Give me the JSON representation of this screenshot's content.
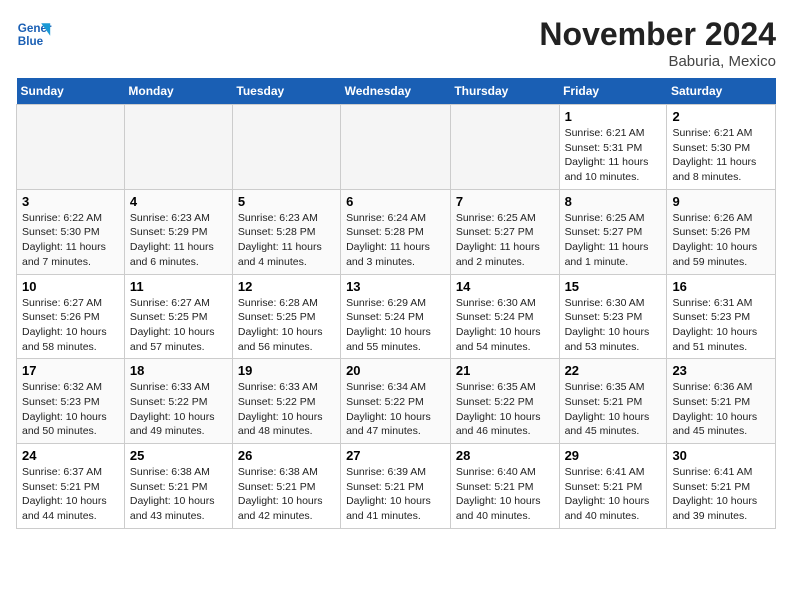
{
  "header": {
    "logo_line1": "General",
    "logo_line2": "Blue",
    "month": "November 2024",
    "location": "Baburia, Mexico"
  },
  "weekdays": [
    "Sunday",
    "Monday",
    "Tuesday",
    "Wednesday",
    "Thursday",
    "Friday",
    "Saturday"
  ],
  "weeks": [
    [
      {
        "day": "",
        "info": ""
      },
      {
        "day": "",
        "info": ""
      },
      {
        "day": "",
        "info": ""
      },
      {
        "day": "",
        "info": ""
      },
      {
        "day": "",
        "info": ""
      },
      {
        "day": "1",
        "info": "Sunrise: 6:21 AM\nSunset: 5:31 PM\nDaylight: 11 hours and 10 minutes."
      },
      {
        "day": "2",
        "info": "Sunrise: 6:21 AM\nSunset: 5:30 PM\nDaylight: 11 hours and 8 minutes."
      }
    ],
    [
      {
        "day": "3",
        "info": "Sunrise: 6:22 AM\nSunset: 5:30 PM\nDaylight: 11 hours and 7 minutes."
      },
      {
        "day": "4",
        "info": "Sunrise: 6:23 AM\nSunset: 5:29 PM\nDaylight: 11 hours and 6 minutes."
      },
      {
        "day": "5",
        "info": "Sunrise: 6:23 AM\nSunset: 5:28 PM\nDaylight: 11 hours and 4 minutes."
      },
      {
        "day": "6",
        "info": "Sunrise: 6:24 AM\nSunset: 5:28 PM\nDaylight: 11 hours and 3 minutes."
      },
      {
        "day": "7",
        "info": "Sunrise: 6:25 AM\nSunset: 5:27 PM\nDaylight: 11 hours and 2 minutes."
      },
      {
        "day": "8",
        "info": "Sunrise: 6:25 AM\nSunset: 5:27 PM\nDaylight: 11 hours and 1 minute."
      },
      {
        "day": "9",
        "info": "Sunrise: 6:26 AM\nSunset: 5:26 PM\nDaylight: 10 hours and 59 minutes."
      }
    ],
    [
      {
        "day": "10",
        "info": "Sunrise: 6:27 AM\nSunset: 5:26 PM\nDaylight: 10 hours and 58 minutes."
      },
      {
        "day": "11",
        "info": "Sunrise: 6:27 AM\nSunset: 5:25 PM\nDaylight: 10 hours and 57 minutes."
      },
      {
        "day": "12",
        "info": "Sunrise: 6:28 AM\nSunset: 5:25 PM\nDaylight: 10 hours and 56 minutes."
      },
      {
        "day": "13",
        "info": "Sunrise: 6:29 AM\nSunset: 5:24 PM\nDaylight: 10 hours and 55 minutes."
      },
      {
        "day": "14",
        "info": "Sunrise: 6:30 AM\nSunset: 5:24 PM\nDaylight: 10 hours and 54 minutes."
      },
      {
        "day": "15",
        "info": "Sunrise: 6:30 AM\nSunset: 5:23 PM\nDaylight: 10 hours and 53 minutes."
      },
      {
        "day": "16",
        "info": "Sunrise: 6:31 AM\nSunset: 5:23 PM\nDaylight: 10 hours and 51 minutes."
      }
    ],
    [
      {
        "day": "17",
        "info": "Sunrise: 6:32 AM\nSunset: 5:23 PM\nDaylight: 10 hours and 50 minutes."
      },
      {
        "day": "18",
        "info": "Sunrise: 6:33 AM\nSunset: 5:22 PM\nDaylight: 10 hours and 49 minutes."
      },
      {
        "day": "19",
        "info": "Sunrise: 6:33 AM\nSunset: 5:22 PM\nDaylight: 10 hours and 48 minutes."
      },
      {
        "day": "20",
        "info": "Sunrise: 6:34 AM\nSunset: 5:22 PM\nDaylight: 10 hours and 47 minutes."
      },
      {
        "day": "21",
        "info": "Sunrise: 6:35 AM\nSunset: 5:22 PM\nDaylight: 10 hours and 46 minutes."
      },
      {
        "day": "22",
        "info": "Sunrise: 6:35 AM\nSunset: 5:21 PM\nDaylight: 10 hours and 45 minutes."
      },
      {
        "day": "23",
        "info": "Sunrise: 6:36 AM\nSunset: 5:21 PM\nDaylight: 10 hours and 45 minutes."
      }
    ],
    [
      {
        "day": "24",
        "info": "Sunrise: 6:37 AM\nSunset: 5:21 PM\nDaylight: 10 hours and 44 minutes."
      },
      {
        "day": "25",
        "info": "Sunrise: 6:38 AM\nSunset: 5:21 PM\nDaylight: 10 hours and 43 minutes."
      },
      {
        "day": "26",
        "info": "Sunrise: 6:38 AM\nSunset: 5:21 PM\nDaylight: 10 hours and 42 minutes."
      },
      {
        "day": "27",
        "info": "Sunrise: 6:39 AM\nSunset: 5:21 PM\nDaylight: 10 hours and 41 minutes."
      },
      {
        "day": "28",
        "info": "Sunrise: 6:40 AM\nSunset: 5:21 PM\nDaylight: 10 hours and 40 minutes."
      },
      {
        "day": "29",
        "info": "Sunrise: 6:41 AM\nSunset: 5:21 PM\nDaylight: 10 hours and 40 minutes."
      },
      {
        "day": "30",
        "info": "Sunrise: 6:41 AM\nSunset: 5:21 PM\nDaylight: 10 hours and 39 minutes."
      }
    ]
  ]
}
